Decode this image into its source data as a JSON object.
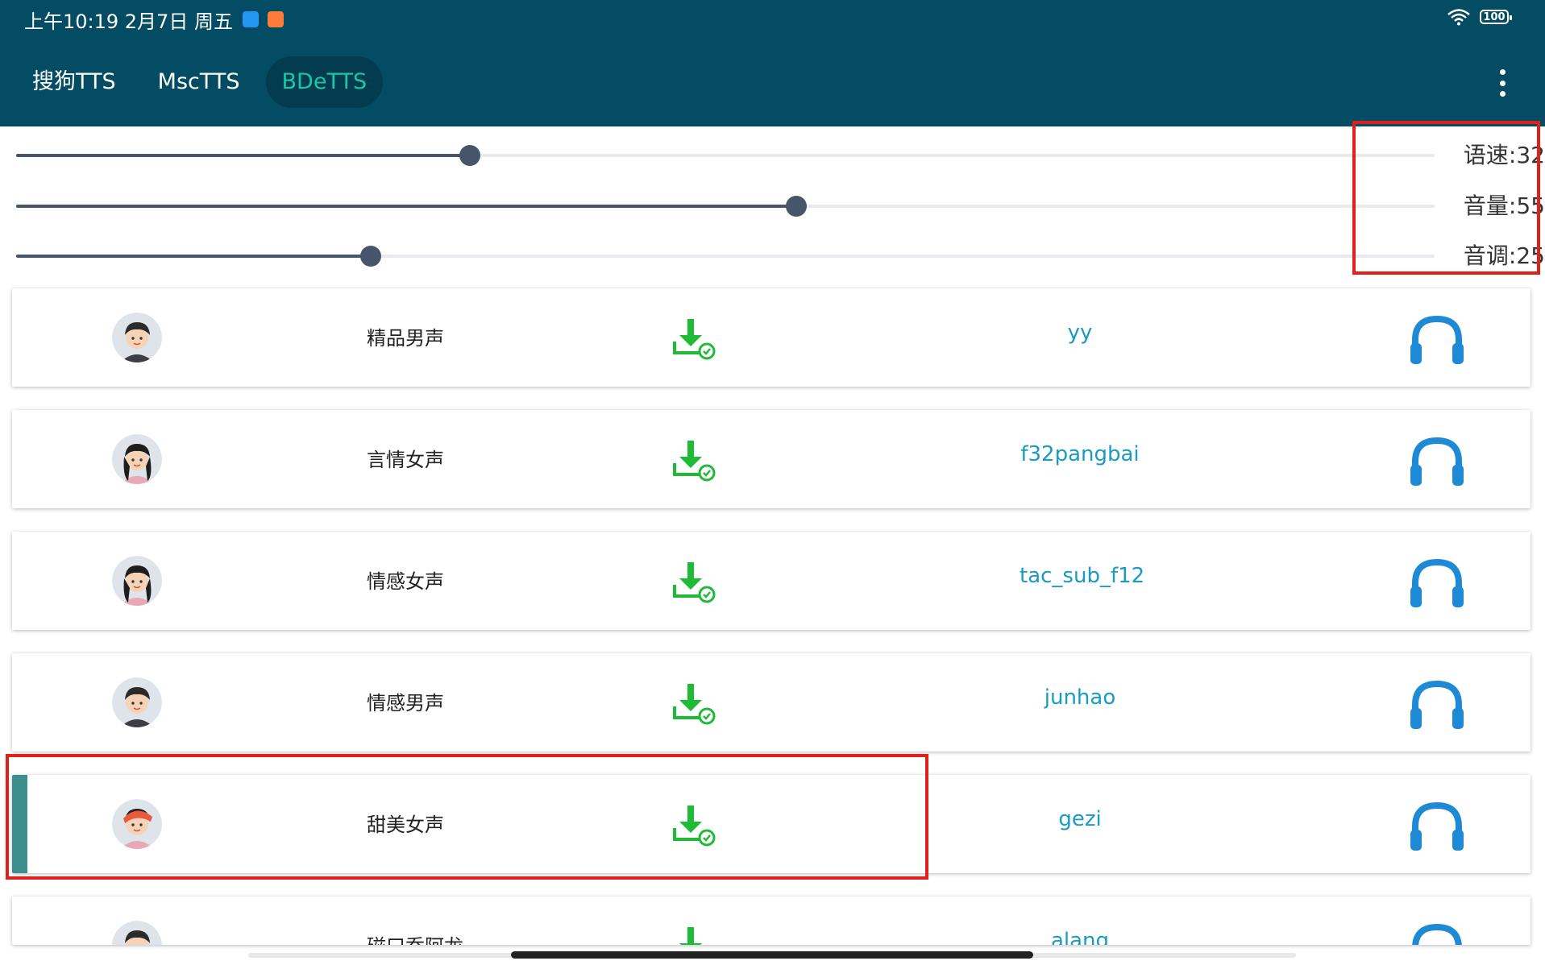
{
  "status_bar": {
    "time": "上午10:19 2月7日 周五",
    "battery": "100",
    "icons": [
      "upload-app-icon",
      "shopping-app-icon",
      "wifi-icon",
      "battery-icon"
    ]
  },
  "tabs": [
    {
      "label": "搜狗TTS",
      "active": false
    },
    {
      "label": "MscTTS",
      "active": false
    },
    {
      "label": "BDeTTS",
      "active": true
    }
  ],
  "menu_icon": "more-vertical-icon",
  "sliders": [
    {
      "label": "语速:32",
      "value": 32,
      "fraction": 0.32
    },
    {
      "label": "音量:55",
      "value": 55,
      "fraction": 0.55
    },
    {
      "label": "音调:25",
      "value": 25,
      "fraction": 0.25
    }
  ],
  "voices": [
    {
      "name": "精品男声",
      "code": "yy",
      "avatar": "male-avatar-icon",
      "selected": false
    },
    {
      "name": "言情女声",
      "code": "f32pangbai",
      "avatar": "female-avatar-icon",
      "selected": false
    },
    {
      "name": "情感女声",
      "code": "tac_sub_f12",
      "avatar": "female-avatar-icon",
      "selected": false
    },
    {
      "name": "情感男声",
      "code": "junhao",
      "avatar": "male-avatar-icon",
      "selected": false
    },
    {
      "name": "甜美女声",
      "code": "gezi",
      "avatar": "female-beret-avatar-icon",
      "selected": true
    },
    {
      "name": "磁口乔阿龙",
      "code": "alang",
      "avatar": "male-avatar-icon",
      "selected": false
    }
  ],
  "colors": {
    "header": "#044c63",
    "active_tab_text": "#18c7a8",
    "download_icon": "#1fba36",
    "headphone_icon": "#1e8ad6",
    "voice_code": "#1a9bc1",
    "selection_accent": "#3c8f8d",
    "highlight_box": "#e0201b"
  }
}
